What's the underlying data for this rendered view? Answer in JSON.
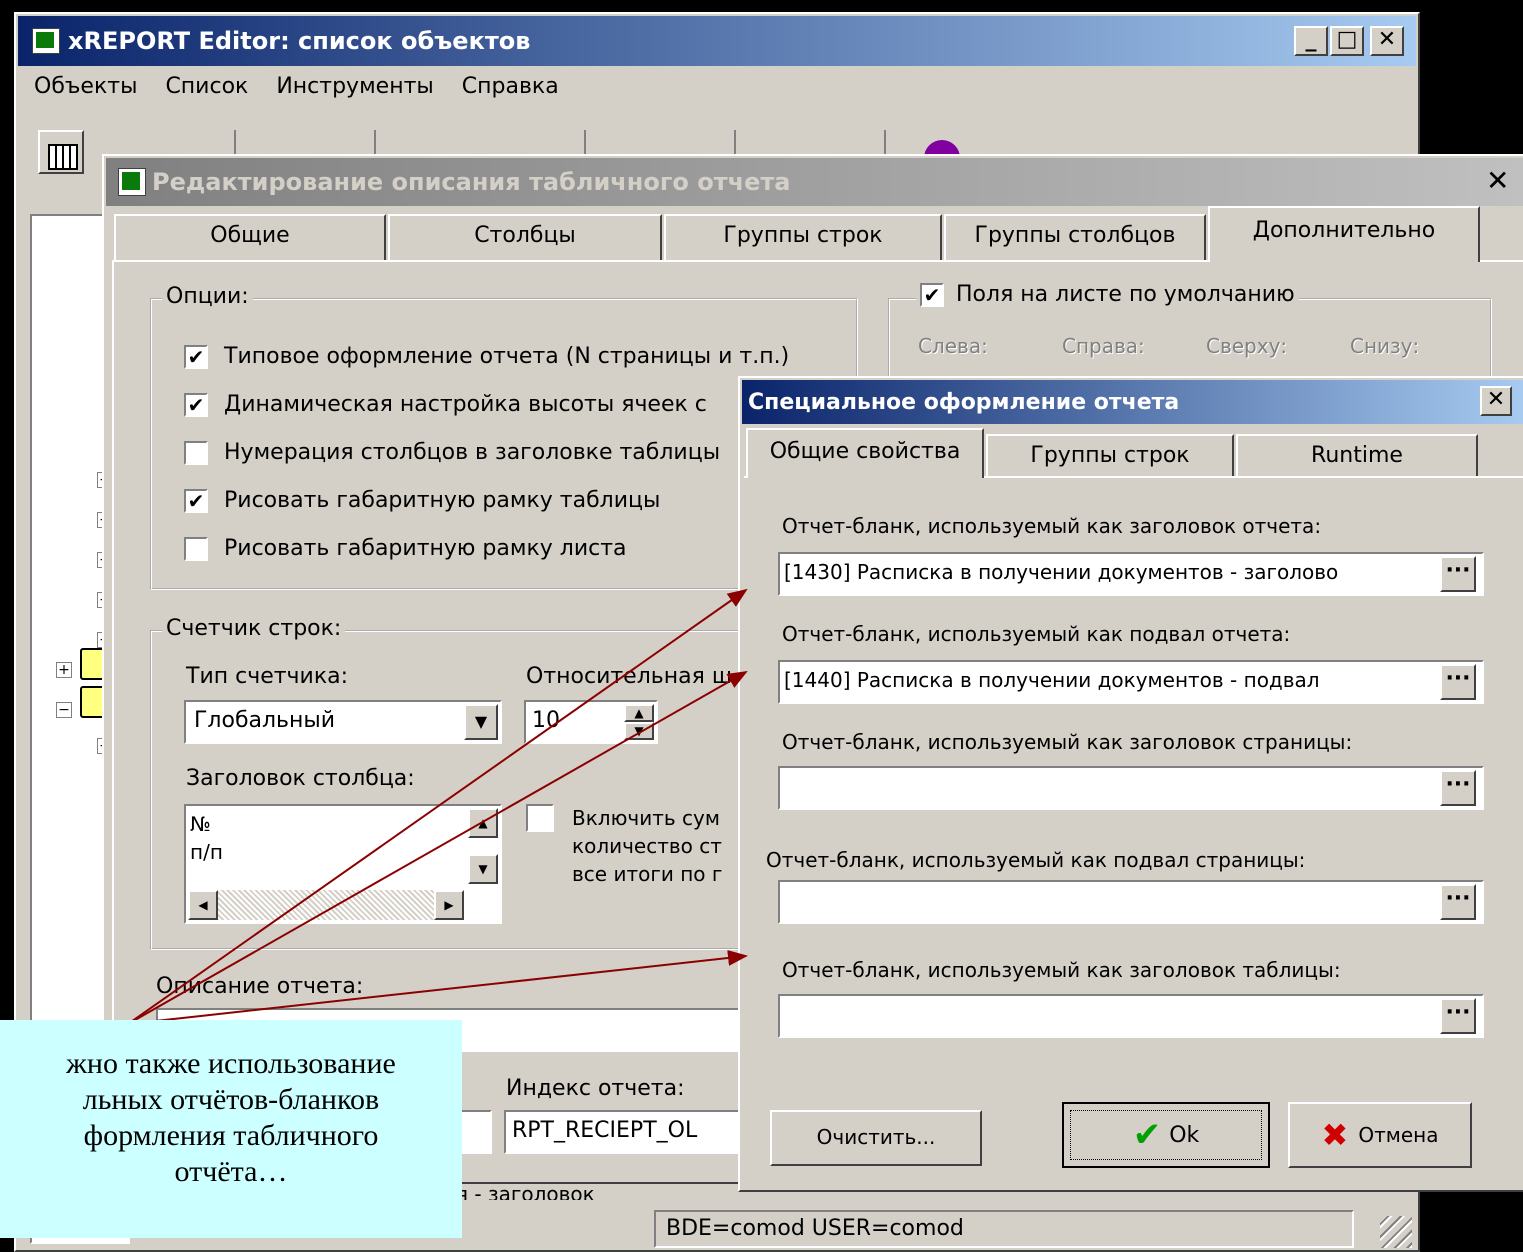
{
  "main_window": {
    "title": "xREPORT Editor: список объектов",
    "menu": [
      "Объекты",
      "Список",
      "Инструменты",
      "Справка"
    ],
    "status_text": "BDE=comod  USER=comod",
    "partial_text": "я - заголовок"
  },
  "edit_dialog": {
    "title": "Редактирование описания табличного отчета",
    "tabs": [
      "Общие",
      "Столбцы",
      "Группы строк",
      "Группы столбцов",
      "Дополнительно"
    ],
    "options_label": "Опции:",
    "options": [
      {
        "label": "Типовое оформление отчета (N страницы и т.п.)",
        "checked": "✔"
      },
      {
        "label": "Динамическая настройка высоты ячеек с",
        "checked": "✔"
      },
      {
        "label": "Нумерация столбцов в заголовке таблицы",
        "checked": ""
      },
      {
        "label": "Рисовать габаритную рамку таблицы",
        "checked": "✔"
      },
      {
        "label": "Рисовать габаритную рамку листа",
        "checked": ""
      }
    ],
    "margins": {
      "checkbox_label": "Поля на листе по умолчанию",
      "checked": "✔",
      "left": "Слева:",
      "right": "Справа:",
      "top": "Сверху:",
      "bottom": "Снизу:"
    },
    "counter": {
      "label": "Счетчик строк:",
      "type_label": "Тип счетчика:",
      "type_value": "Глобальный",
      "width_label": "Относительная ш",
      "width_value": "10",
      "header_label": "Заголовок столбца:",
      "header_lines": [
        "№",
        "п/п"
      ],
      "sum_lines": [
        "Включить сум",
        "количество ст",
        "все итоги по г"
      ]
    },
    "description_label": "Описание отчета:",
    "index_label": "Индекс отчета:",
    "index_value": "RPT_RECIEPT_OL"
  },
  "special_dialog": {
    "title": "Специальное оформление отчета",
    "tabs": [
      "Общие свойства",
      "Группы строк",
      "Runtime"
    ],
    "fields": [
      {
        "label": "Отчет-бланк, используемый как заголовок отчета:",
        "value": "[1430]  Расписка в получении документов - заголово"
      },
      {
        "label": "Отчет-бланк, используемый как подвал отчета:",
        "value": "[1440]  Расписка в получении документов - подвал"
      },
      {
        "label": "Отчет-бланк, используемый как заголовок страницы:",
        "value": ""
      },
      {
        "label": "Отчет-бланк, используемый как подвал страницы:",
        "value": ""
      },
      {
        "label": "Отчет-бланк, используемый как заголовок таблицы:",
        "value": ""
      }
    ],
    "ellipsis": "···",
    "clear_button": "Очистить...",
    "ok_button": "Ok",
    "cancel_button": "Отмена"
  },
  "callout": {
    "lines": [
      "жно также использование",
      "льных отчётов-бланков",
      "формления табличного",
      "отчёта…"
    ]
  },
  "colors": {
    "titlebar": "#0a246a",
    "window": "#d4d0c8",
    "callout": "#ccffff",
    "arrow": "#8b0000"
  }
}
